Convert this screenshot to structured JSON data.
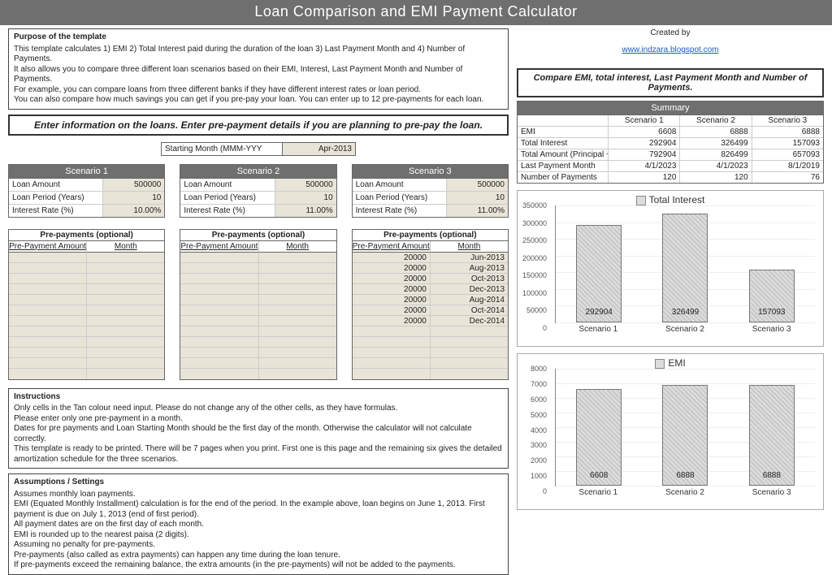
{
  "title": "Loan Comparison and EMI Payment Calculator",
  "credit": {
    "label": "Created by",
    "url_text": "www.indzara.blogspot.com"
  },
  "purpose": {
    "heading": "Purpose of the template",
    "lines": [
      "This template calculates 1) EMI 2) Total Interest paid during the duration of the loan 3) Last Payment Month and 4) Number of Payments.",
      "It also allows you to compare three different loan scenarios based on their EMI, Interest, Last Payment Month and Number of Payments.",
      "For example, you can compare loans from three different banks if they have different interest rates or loan period.",
      "You can also compare how much savings you can get if you pre-pay your loan. You can enter up to 12 pre-payments for each loan."
    ]
  },
  "enter_prompt": "Enter information on the loans. Enter pre-payment details if you are planning to pre-pay the loan.",
  "compare_prompt": "Compare EMI, total interest, Last Payment Month and Number of Payments.",
  "starting_month": {
    "label": "Starting Month (MMM-YYY",
    "value": "Apr-2013"
  },
  "scenario_labels": {
    "loan_amount": "Loan Amount",
    "loan_period": "Loan Period (Years)",
    "interest_rate": "Interest Rate (%)"
  },
  "scenarios": [
    {
      "name": "Scenario 1",
      "loan_amount": "500000",
      "loan_period": "10",
      "interest_rate": "10.00%"
    },
    {
      "name": "Scenario 2",
      "loan_amount": "500000",
      "loan_period": "10",
      "interest_rate": "11.00%"
    },
    {
      "name": "Scenario 3",
      "loan_amount": "500000",
      "loan_period": "10",
      "interest_rate": "11.00%"
    }
  ],
  "prepay": {
    "heading": "Pre-payments (optional)",
    "col_amount": "Pre-Payment Amount",
    "col_month": "Month",
    "s1": [
      [
        "",
        ""
      ],
      [
        "",
        ""
      ],
      [
        "",
        ""
      ],
      [
        "",
        ""
      ],
      [
        "",
        ""
      ],
      [
        "",
        ""
      ],
      [
        "",
        ""
      ],
      [
        "",
        ""
      ],
      [
        "",
        ""
      ],
      [
        "",
        ""
      ],
      [
        "",
        ""
      ],
      [
        "",
        ""
      ]
    ],
    "s2": [
      [
        "",
        ""
      ],
      [
        "",
        ""
      ],
      [
        "",
        ""
      ],
      [
        "",
        ""
      ],
      [
        "",
        ""
      ],
      [
        "",
        ""
      ],
      [
        "",
        ""
      ],
      [
        "",
        ""
      ],
      [
        "",
        ""
      ],
      [
        "",
        ""
      ],
      [
        "",
        ""
      ],
      [
        "",
        ""
      ]
    ],
    "s3": [
      [
        "20000",
        "Jun-2013"
      ],
      [
        "20000",
        "Aug-2013"
      ],
      [
        "20000",
        "Oct-2013"
      ],
      [
        "20000",
        "Dec-2013"
      ],
      [
        "20000",
        "Aug-2014"
      ],
      [
        "20000",
        "Oct-2014"
      ],
      [
        "20000",
        "Dec-2014"
      ],
      [
        "",
        ""
      ],
      [
        "",
        ""
      ],
      [
        "",
        ""
      ],
      [
        "",
        ""
      ],
      [
        "",
        ""
      ]
    ]
  },
  "instructions": {
    "heading": "Instructions",
    "lines": [
      "Only cells in the Tan colour need input. Please do not change any of the other cells, as they have formulas.",
      "Please enter only one pre-payment in a  month.",
      "Dates for pre payments and Loan Starting Month should be the first day of the month. Otherwise the calculator will not calculate correctly.",
      "This template is ready to be printed. There will be 7 pages when you print. First one is this page and the remaining six gives the detailed amortization schedule for the three scenarios."
    ]
  },
  "assumptions": {
    "heading": "Assumptions / Settings",
    "lines": [
      "Assumes monthly loan payments.",
      "EMI (Equated Monthly Installment) calculation is for the end of the period. In the example above, loan begins on June 1, 2013. First payment is due on July 1, 2013 (end of first period).",
      "All payment dates are on the first day of each month.",
      "EMI is rounded up to the nearest paisa (2 digits).",
      "Assuming no penalty for pre-payments.",
      "Pre-payments (also called as extra payments) can happen any time during the loan tenure.",
      "If pre-payments exceed the remaining balance, the extra amounts (in the pre-payments) will not be added to the payments."
    ]
  },
  "summary": {
    "title": "Summary",
    "cols": [
      "Scenario 1",
      "Scenario 2",
      "Scenario 3"
    ],
    "rows": [
      {
        "label": "EMI",
        "v": [
          "6608",
          "6888",
          "6888"
        ]
      },
      {
        "label": "Total Interest",
        "v": [
          "292904",
          "326499",
          "157093"
        ]
      },
      {
        "label": "Total Amount (Principal + Interest)",
        "v": [
          "792904",
          "826499",
          "657093"
        ]
      },
      {
        "label": "Last Payment Month",
        "v": [
          "4/1/2023",
          "4/1/2023",
          "8/1/2019"
        ]
      },
      {
        "label": "Number of Payments",
        "v": [
          "120",
          "120",
          "76"
        ]
      }
    ]
  },
  "chart_data": [
    {
      "type": "bar",
      "title": "Total Interest",
      "categories": [
        "Scenario 1",
        "Scenario 2",
        "Scenario 3"
      ],
      "values": [
        292904,
        326499,
        157093
      ],
      "ylim": [
        0,
        350000
      ],
      "yticks": [
        0,
        50000,
        100000,
        150000,
        200000,
        250000,
        300000,
        350000
      ]
    },
    {
      "type": "bar",
      "title": "EMI",
      "categories": [
        "Scenario 1",
        "Scenario 2",
        "Scenario 3"
      ],
      "values": [
        6608,
        6888,
        6888
      ],
      "ylim": [
        0,
        8000
      ],
      "yticks": [
        0,
        1000,
        2000,
        3000,
        4000,
        5000,
        6000,
        7000,
        8000
      ]
    }
  ]
}
